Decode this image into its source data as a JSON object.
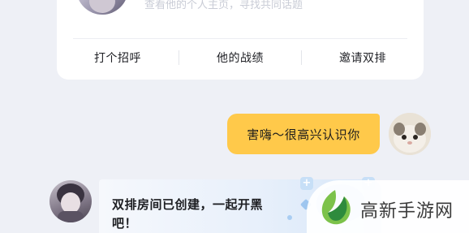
{
  "profile_card": {
    "intro_text": "查看他的个人主页，寻找共同话题",
    "actions": [
      {
        "label": "打个招呼"
      },
      {
        "label": "他的战绩"
      },
      {
        "label": "邀请双排"
      }
    ]
  },
  "messages": [
    {
      "direction": "out",
      "text": "害嗨～很高兴认识你",
      "bubble_color": "#ffc94a"
    },
    {
      "direction": "in",
      "text": "双排房间已创建，一起开黑吧！"
    }
  ],
  "watermark": {
    "text": "高新手游网",
    "logo_colors": [
      "#7cc24a",
      "#2e8b3d"
    ]
  }
}
